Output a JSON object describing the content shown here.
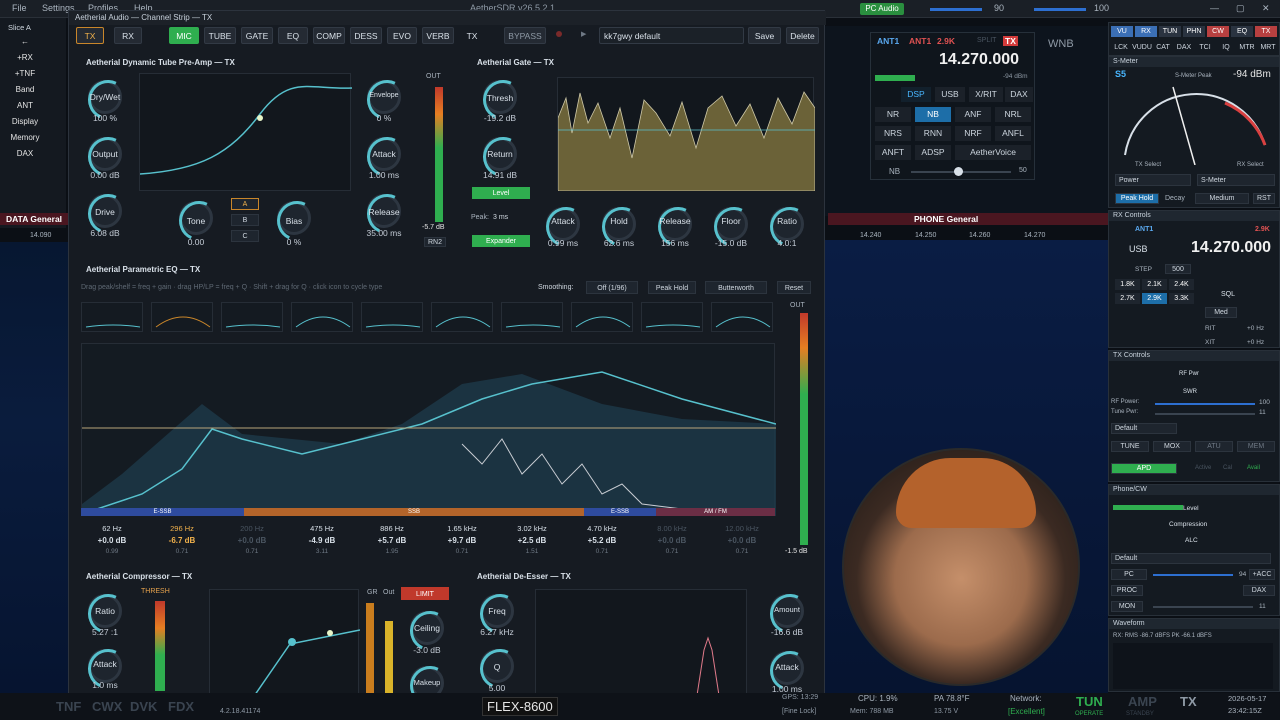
{
  "menu": {
    "file": "File",
    "settings": "Settings",
    "profiles": "Profiles",
    "help": "Help",
    "app_title": "AetherSDR v26.5.2.1"
  },
  "left": {
    "slice": "Slice A",
    "items": [
      "←",
      "+RX",
      "+TNF",
      "Band",
      "ANT",
      "Display",
      "Memory",
      "DAX"
    ],
    "spot": "DATA General",
    "freq": "14.090"
  },
  "pc_audio": "PC Audio",
  "vol1": "90",
  "vol2": "100",
  "strip": {
    "title": "Aetherial Audio — Channel Strip — TX",
    "tabs": [
      "TX",
      "RX",
      "MIC",
      "TUBE",
      "GATE",
      "EQ",
      "COMP",
      "DESS",
      "EVO",
      "VERB",
      "TX"
    ],
    "bypass": "BYPASS",
    "preset": "kk7gwy default",
    "save": "Save",
    "delete": "Delete"
  },
  "tube": {
    "title": "Aetherial Dynamic Tube Pre-Amp — TX",
    "drywet": "Dry/Wet",
    "drywet_val": "100 %",
    "output": "Output",
    "output_val": "0.00 dB",
    "drive": "Drive",
    "drive_val": "6.08 dB",
    "tone": "Tone",
    "tone_val": "0.00",
    "bias": "Bias",
    "bias_val": "0 %",
    "abc": [
      "A",
      "B",
      "C"
    ],
    "envelope": "Envelope",
    "envelope_val": "0 %",
    "attack": "Attack",
    "attack_val": "1.00 ms",
    "release": "Release",
    "release_val": "35.00 ms",
    "out": "OUT",
    "meter": "-5.7 dB",
    "rn2": "RN2"
  },
  "gate": {
    "title": "Aetherial Gate — TX",
    "thresh": "Thresh",
    "thresh_val": "-19.2 dB",
    "return": "Return",
    "return_val": "14.91 dB",
    "level": "Level",
    "peak_label": "Peak:",
    "peak_val": "3 ms",
    "expander": "Expander",
    "knobs": [
      [
        "Attack",
        "0.99 ms"
      ],
      [
        "Hold",
        "62.6 ms"
      ],
      [
        "Release",
        "156 ms"
      ],
      [
        "Floor",
        "-15.0 dB"
      ],
      [
        "Ratio",
        "4.0:1"
      ]
    ]
  },
  "eq": {
    "title": "Aetherial Parametric EQ — TX",
    "hint": "Drag peak/shelf = freq + gain · drag HP/LP = freq + Q · Shift + drag for Q · click icon to cycle type",
    "smoothing": "Smoothing:",
    "smoothing_val": "Off (1/96)",
    "peak_hold": "Peak Hold",
    "filter": "Butterworth",
    "reset": "Reset",
    "out": "OUT",
    "meter_val": "-1.5 dB",
    "bands": [
      [
        "62 Hz",
        "+0.0 dB",
        "0.99"
      ],
      [
        "296 Hz",
        "-6.7 dB",
        "0.71"
      ],
      [
        "200 Hz",
        "+0.0 dB",
        "0.71"
      ],
      [
        "475 Hz",
        "-4.9 dB",
        "3.11"
      ],
      [
        "886 Hz",
        "+5.7 dB",
        "1.95"
      ],
      [
        "1.65 kHz",
        "+9.7 dB",
        "0.71"
      ],
      [
        "3.02 kHz",
        "+2.5 dB",
        "1.51"
      ],
      [
        "4.70 kHz",
        "+5.2 dB",
        "0.71"
      ],
      [
        "8.00 kHz",
        "+0.0 dB",
        "0.71"
      ],
      [
        "12.00 kHz",
        "+0.0 dB",
        "0.71"
      ]
    ],
    "ranges": [
      "E-SSB",
      "SSB",
      "E-SSB",
      "AM / FM"
    ]
  },
  "comp": {
    "title": "Aetherial Compressor — TX",
    "ratio": "Ratio",
    "ratio_val": "5.27 :1",
    "attack": "Attack",
    "attack_val": "1.0 ms",
    "thresh": "THRESH",
    "gr": "GR",
    "out": "Out",
    "limit": "LIMIT",
    "ceiling": "Ceiling",
    "ceiling_val": "-3.0 dB",
    "makeup": "Makeup"
  },
  "deess": {
    "title": "Aetherial De-Esser — TX",
    "freq": "Freq",
    "freq_val": "6.27 kHz",
    "q": "Q",
    "q_val": "5.00",
    "amount": "Amount",
    "amount_val": "-16.6 dB",
    "attack": "Attack",
    "attack_val": "1.00 ms"
  },
  "pan": {
    "ant1": "ANT1",
    "ant1b": "ANT1",
    "bw": "2.9K",
    "tx": "TX",
    "split": "SPLIT",
    "freq": "14.270.000",
    "wnb": "WNB",
    "dbm": "-94 dBm",
    "modes": [
      "DSP",
      "USB",
      "X/RIT",
      "DAX"
    ],
    "dsp": [
      "NR",
      "NB",
      "ANF",
      "NRL",
      "NRS",
      "RNN",
      "NRF",
      "ANFL",
      "ANFT",
      "ADSP",
      "AetherVoice"
    ],
    "nb": "NB",
    "nb_val": "50",
    "spot": "PHONE General",
    "ticks": [
      "14.240",
      "14.250",
      "14.260",
      "14.270"
    ]
  },
  "right": {
    "top": [
      "VU",
      "RX",
      "TUN",
      "PHN",
      "CW",
      "EQ",
      "TX"
    ],
    "top2": [
      "LCK",
      "VUDU",
      "CAT",
      "DAX",
      "TCI",
      "IQ",
      "MTR",
      "MRT"
    ],
    "smeter": "S-Meter",
    "s5": "S5",
    "peak_label": "S-Meter Peak",
    "peak": "-94 dBm",
    "tx_select": "TX Select",
    "rx_select": "RX Select",
    "power": "Power",
    "smeter_sel": "S-Meter",
    "peak_hold": "Peak Hold",
    "decay": "Decay",
    "medium": "Medium",
    "rst": "RST",
    "rx_controls": "RX Controls",
    "rx_freq": "14.270.000",
    "usb": "USB",
    "step": "STEP",
    "step_val": "500",
    "filters": [
      "1.8K",
      "2.1K",
      "2.4K",
      "2.7K",
      "2.9K",
      "3.3K"
    ],
    "sql": "SQL",
    "med": "Med",
    "rit": "RIT",
    "xit": "XIT",
    "hz": "+0 Hz",
    "tx_controls": "TX Controls",
    "rf_pwr": "RF Pwr",
    "swr": "SWR",
    "rf_power": "RF Power:",
    "rf_power_val": "100",
    "tune_pwr": "Tune Pwr:",
    "tune_pwr_val": "11",
    "default": "Default",
    "tune": "TUNE",
    "mox": "MOX",
    "atu": "ATU",
    "mem": "MEM",
    "apd": "APD",
    "active": "Active",
    "cal": "Cal",
    "avail": "Avail",
    "phone_cw": "Phone/CW",
    "level": "Level",
    "compression": "Compression",
    "alc": "ALC",
    "default2": "Default",
    "pc": "PC",
    "pc_val": "94",
    "acc": "+ACC",
    "proc": "PROC",
    "dax": "DAX",
    "mon": "MON",
    "mon_val": "11",
    "waveform": "Waveform",
    "wf_rms": "RX: RMS -86.7 dBFS  PK -66.1 dBFS"
  },
  "status": {
    "tnf": "TNF",
    "cwx": "CWX",
    "dvk": "DVK",
    "fdx": "FDX",
    "radio": "FLEX-8600",
    "version": "4.2.18.41174",
    "cpu": "CPU: 1.9%",
    "mem": "Mem: 788 MB",
    "pa": "PA 78.8°F",
    "volt": "13.75 V",
    "network": "Network:",
    "network_val": "[Excellent]",
    "tun": "TUN",
    "operate": "OPERATE",
    "amp": "AMP",
    "standby": "STANDBY",
    "tx": "TX",
    "date": "2026-05-17",
    "time": "23:42:15Z",
    "gps": "GPS: 13:29",
    "fine": "[Fine Lock]"
  }
}
